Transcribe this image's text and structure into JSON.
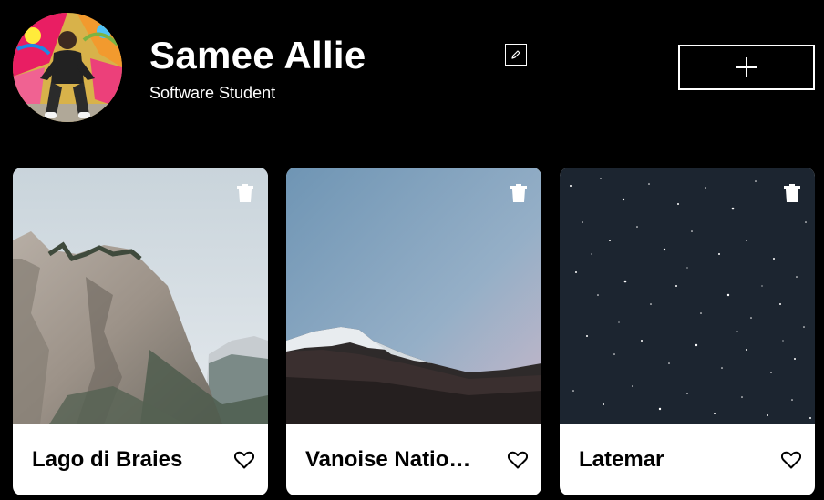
{
  "profile": {
    "name": "Samee Allie",
    "about": "Software Student",
    "avatar_alt": "avatar photo",
    "edit_icon": "pencil-icon",
    "add_icon": "plus-icon"
  },
  "cards": [
    {
      "title": "Lago di Braies",
      "image": "rocky mountain cliff",
      "delete_icon": "trash-icon",
      "like_icon": "heart-outline-icon",
      "liked": false
    },
    {
      "title": "Vanoise Natio…",
      "image": "snowy peak at dusk",
      "delete_icon": "trash-icon",
      "like_icon": "heart-outline-icon",
      "liked": false
    },
    {
      "title": "Latemar",
      "image": "starry night sky",
      "delete_icon": "trash-icon",
      "like_icon": "heart-outline-icon",
      "liked": false
    }
  ],
  "colors": {
    "background": "#000000",
    "card_background": "#ffffff",
    "text_primary": "#ffffff",
    "card_text": "#000000"
  }
}
